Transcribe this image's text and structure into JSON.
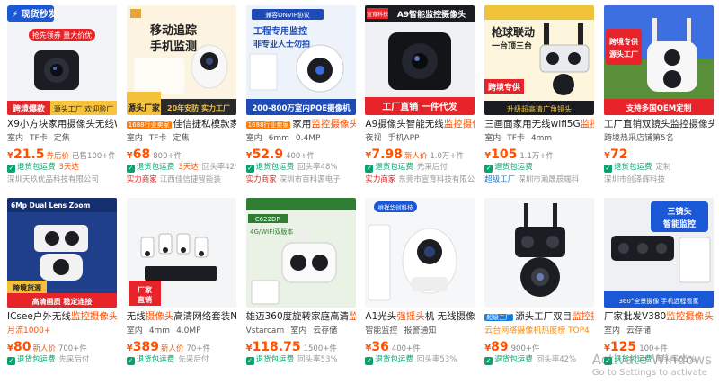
{
  "products": [
    {
      "thumb_text": "现货秒发",
      "thumb_text2": "抢先领券 量大价优",
      "thumb_text3": "跨境爆款",
      "thumb_text4": "源头工厂 欢迎验厂",
      "title": "X9小方块家用摄像头无线W",
      "highlight": "",
      "tags": [
        "室内",
        "TF卡",
        "定焦"
      ],
      "price": "21.5",
      "price_badge": "券后价",
      "sales": "已售100+件",
      "service": "退货包运费",
      "service2": "3天达",
      "service3": "",
      "shop_badge": "",
      "shop": "深圳天玖优品科技有限公司"
    },
    {
      "thumb_text": "移动追踪",
      "thumb_text2": "手机监测",
      "thumb_text3": "源头厂家",
      "thumb_text4": "20年安防 实力工厂",
      "title": "佳信捷私模款家用",
      "title_prefix": "1688行业卖家",
      "highlight": "",
      "tags": [
        "室内",
        "TF卡",
        "定焦"
      ],
      "price": "68",
      "price_badge": "",
      "sales": "800+件",
      "service": "退货包运费",
      "service2": "3天达",
      "service3": "回头率42%",
      "shop_badge": "实力商家",
      "shop": "江西佳信捷智能装"
    },
    {
      "thumb_text": "工程专用监控",
      "thumb_text2": "非专业人士勿拍",
      "thumb_text3": "200-800万室内POE摄像机",
      "thumb_text4": "兼容ONVIF协议",
      "title": "家用",
      "title_prefix": "1688行业卖家",
      "highlight": "监控摄像头",
      "title_suffix": "半",
      "tags": [
        "室内",
        "6mm",
        "0.4MP"
      ],
      "price": "52.9",
      "price_badge": "",
      "sales": "400+件",
      "service": "退货包运费",
      "service2": "",
      "service3": "回头率48%",
      "shop_badge": "实力商家",
      "shop": "深圳市百科源电子"
    },
    {
      "thumb_text": "A9智能监控摄像头",
      "thumb_text2": "宣育科技",
      "thumb_text3": "工厂直销 一件代发",
      "thumb_text4": "",
      "title": "A9摄像头智能无线",
      "highlight": "监控摄像",
      "title_suffix": "",
      "tags": [
        "夜视",
        "手机APP"
      ],
      "price": "7.98",
      "price_badge": "新人价",
      "sales": "1.0万+件",
      "service": "退货包运费",
      "service2": "",
      "service3": "先采后付",
      "shop_badge": "实力商家",
      "shop": "东莞市宣育科技有限公司"
    },
    {
      "thumb_text": "枪球联动",
      "thumb_text2": "一台顶三台",
      "thumb_text3": "跨境专供",
      "thumb_text4": "升级超高清广角镜头",
      "title": "三画面家用无线wifi5G",
      "highlight": "监控",
      "title_suffix": "",
      "tags": [
        "室内",
        "TF卡",
        "4mm"
      ],
      "price": "105",
      "price_badge": "",
      "sales": "1.1万+件",
      "service": "退货包运费",
      "service2": "",
      "service3": "",
      "shop_badge": "超级工厂",
      "shop": "深圳市瀚晟辰端科"
    },
    {
      "thumb_text": "跨境专供",
      "thumb_text2": "源头工厂",
      "thumb_text3": "支持多国OEM定制",
      "thumb_text4": "",
      "title": "工厂直销双镜头监控摄像头",
      "highlight": "",
      "title_suffix": "",
      "tags": [
        "跨境热采店铺第5名"
      ],
      "price": "72",
      "price_badge": "",
      "sales": "",
      "service": "退货包运费",
      "service2": "",
      "service3": "定制",
      "shop_badge": "",
      "shop": "深圳市创泽辉科技"
    },
    {
      "thumb_text": "6Mp Dual Lens Zoom",
      "thumb_text2": "跨境货源",
      "thumb_text3": "高清画质 稳定连接",
      "thumb_text4": "",
      "title": "ICsee户外无线",
      "highlight": "监控摄像头",
      "title_suffix": "",
      "tags": [
        "月流1000+"
      ],
      "price": "80",
      "price_badge": "新人价",
      "sales": "700+件",
      "service": "退货包运费",
      "service2": "",
      "service3": "先采后付",
      "shop_badge": "",
      "shop": ""
    },
    {
      "thumb_text": "厂家直销",
      "thumb_text2": "",
      "thumb_text3": "",
      "thumb_text4": "",
      "title": "无线",
      "highlight": "摄像头",
      "title_suffix": "高清网络套装N",
      "tags": [
        "室内",
        "4mm",
        "4.0MP"
      ],
      "price": "389",
      "price_badge": "新人价",
      "sales": "70+件",
      "service": "退货包运费",
      "service2": "",
      "service3": "先采后付",
      "shop_badge": "",
      "shop": ""
    },
    {
      "thumb_text": "C622DR",
      "thumb_text2": "4G/WIFI双版本",
      "thumb_text3": "",
      "thumb_text4": "",
      "title": "雄迈360度旋转家庭高清",
      "highlight": "监",
      "title_suffix": "",
      "tags": [
        "Vstarcam",
        "室内",
        "云存储"
      ],
      "price": "118.75",
      "price_badge": "",
      "sales": "1500+件",
      "service": "退货包运费",
      "service2": "",
      "service3": "回头率53%",
      "shop_badge": "",
      "shop": ""
    },
    {
      "thumb_text": "维祥华创科技",
      "thumb_text2": "",
      "thumb_text3": "",
      "thumb_text4": "",
      "title": "A1光头",
      "highlight": "强摇头",
      "title_suffix": "机 无线摄像",
      "tags": [
        "智能监控",
        "报警通知"
      ],
      "price": "36",
      "price_badge": "",
      "sales": "400+件",
      "service": "退货包运费",
      "service2": "",
      "service3": "回头率53%",
      "shop_badge": "",
      "shop": ""
    },
    {
      "thumb_text": "",
      "thumb_text2": "",
      "thumb_text3": "",
      "thumb_text4": "",
      "title": "源头工厂双目",
      "title_prefix": "超级工厂",
      "highlight": "监控摄像头",
      "title_suffix": "枪",
      "tags": [
        "云台网络摄像机热度榜 TOP4"
      ],
      "price": "89",
      "price_badge": "",
      "sales": "900+件",
      "service": "退货包运费",
      "service2": "",
      "service3": "回头率42%",
      "shop_badge": "",
      "shop": ""
    },
    {
      "thumb_text": "三镜头",
      "thumb_text2": "智能监控",
      "thumb_text3": "360°全景摄像 手机远程看家",
      "thumb_text4": "",
      "title": "厂家批发V380",
      "highlight": "监控摄像头",
      "title_suffix": "",
      "tags": [
        "室内",
        "云存储"
      ],
      "price": "125",
      "price_badge": "",
      "sales": "100+件",
      "service": "退货包运费",
      "service2": "",
      "service3": "回头率65%",
      "shop_badge": "",
      "shop": ""
    }
  ],
  "watermark": {
    "line1": "Activate Windows",
    "line2": "Go to Settings to activate"
  },
  "currency": "¥"
}
